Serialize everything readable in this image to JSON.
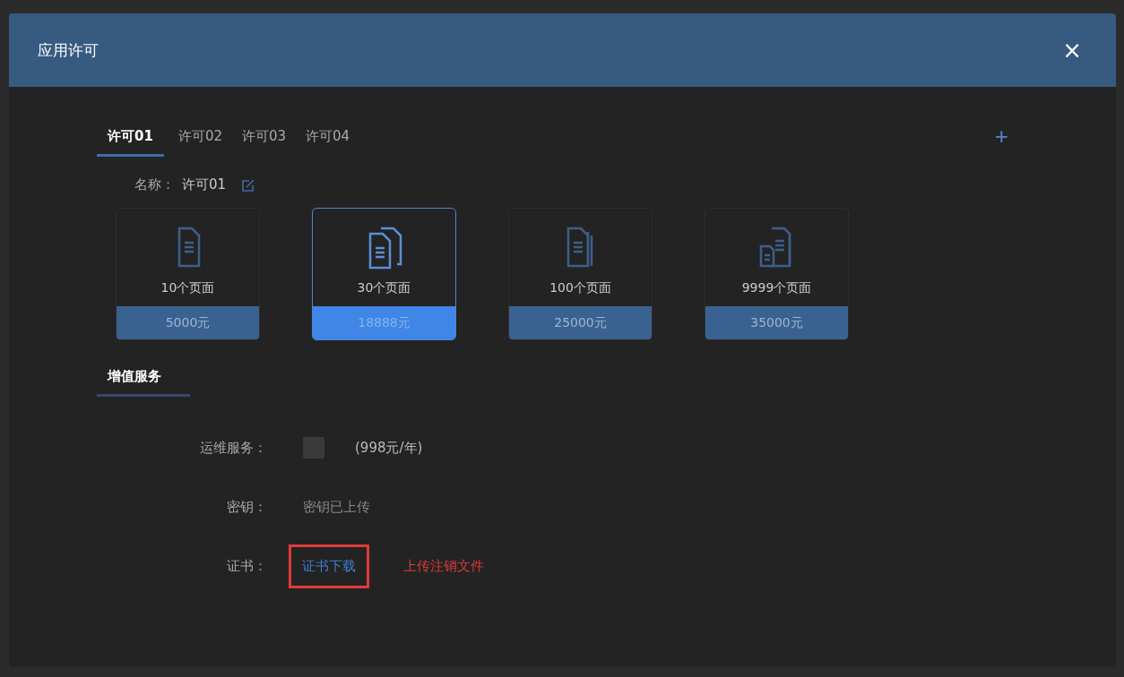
{
  "dialog": {
    "title": "应用许可",
    "close": "×"
  },
  "tabs": [
    {
      "label": "许可01",
      "selected": true
    },
    {
      "label": "许可02",
      "selected": false
    },
    {
      "label": "许可03",
      "selected": false
    },
    {
      "label": "许可04",
      "selected": false
    }
  ],
  "add_button": "+",
  "name_field": {
    "label": "名称：",
    "value": "许可01"
  },
  "plans": [
    {
      "kind": "single",
      "pages": "10个页面",
      "price": "5000元",
      "selected": false
    },
    {
      "kind": "double",
      "pages": "30个页面",
      "price": "18888元",
      "selected": true
    },
    {
      "kind": "stack",
      "pages": "100个页面",
      "price": "25000元",
      "selected": false
    },
    {
      "kind": "multi",
      "pages": "9999个页面",
      "price": "35000元",
      "selected": false
    }
  ],
  "section_title": "增值服务",
  "services": [
    {
      "kind": "checkbox",
      "label": "运维服务：",
      "checked": false,
      "note": "(998元/年)"
    },
    {
      "kind": "text",
      "label": "密钥：",
      "value": "密钥已上传"
    },
    {
      "kind": "links",
      "label": "证书：",
      "link": "证书下载",
      "highlighted": true,
      "danger_link": "上传注销文件"
    }
  ]
}
